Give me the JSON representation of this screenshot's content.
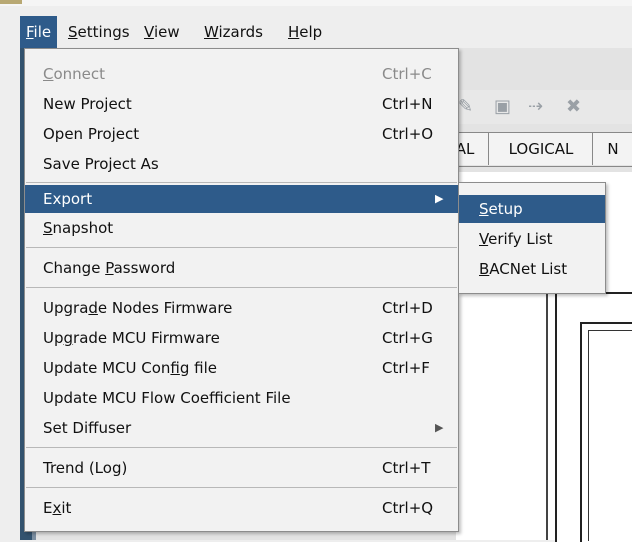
{
  "menubar": {
    "items": [
      {
        "label": "File",
        "mnemonic_first": "F",
        "rest": "ile"
      },
      {
        "label": "Settings",
        "mnemonic_first": "S",
        "rest": "ettings"
      },
      {
        "label": "View",
        "mnemonic_first": "V",
        "rest": "iew"
      },
      {
        "label": "Wizards",
        "mnemonic_first": "W",
        "rest": "izards"
      },
      {
        "label": "Help",
        "mnemonic_first": "H",
        "rest": "elp"
      }
    ]
  },
  "background": {
    "tabs": [
      "AL",
      "LOGICAL",
      "N"
    ]
  },
  "file_menu": {
    "items": [
      {
        "pre": "",
        "u": "C",
        "post": "onnect",
        "accel": "Ctrl+C"
      },
      {
        "pre": "New Project",
        "u": "",
        "post": "",
        "accel": "Ctrl+N"
      },
      {
        "pre": "Open Project",
        "u": "",
        "post": "",
        "accel": "Ctrl+O"
      },
      {
        "pre": "Save Project As",
        "u": "",
        "post": "",
        "accel": ""
      },
      {
        "pre": "Export",
        "u": "",
        "post": "",
        "accel": ""
      },
      {
        "pre": "",
        "u": "S",
        "post": "napshot",
        "accel": ""
      },
      {
        "pre": "Change ",
        "u": "P",
        "post": "assword",
        "accel": ""
      },
      {
        "pre": "Upgra",
        "u": "d",
        "post": "e Nodes Firmware",
        "accel": "Ctrl+D"
      },
      {
        "pre": "Up",
        "u": "g",
        "post": "rade MCU Firmware",
        "accel": "Ctrl+G"
      },
      {
        "pre": "Update MCU Con",
        "u": "f",
        "post": "ig file",
        "accel": "Ctrl+F"
      },
      {
        "pre": "Update MCU Flow Coefficient File",
        "u": "",
        "post": "",
        "accel": ""
      },
      {
        "pre": "Set Diffuser",
        "u": "",
        "post": "",
        "accel": ""
      },
      {
        "pre": "Trend (Log)",
        "u": "",
        "post": "",
        "accel": "Ctrl+T"
      },
      {
        "pre": "E",
        "u": "x",
        "post": "it",
        "accel": "Ctrl+Q"
      }
    ],
    "submenu_arrow": "▶"
  },
  "export_submenu": {
    "items": [
      {
        "u": "S",
        "post": "etup"
      },
      {
        "u": "V",
        "post": "erify List"
      },
      {
        "u": "B",
        "post": "ACNet List"
      }
    ]
  },
  "colors": {
    "highlight": "#2e5b8a",
    "menu_bg": "#f2f2f2",
    "disabled_text": "#8a8a8a"
  }
}
